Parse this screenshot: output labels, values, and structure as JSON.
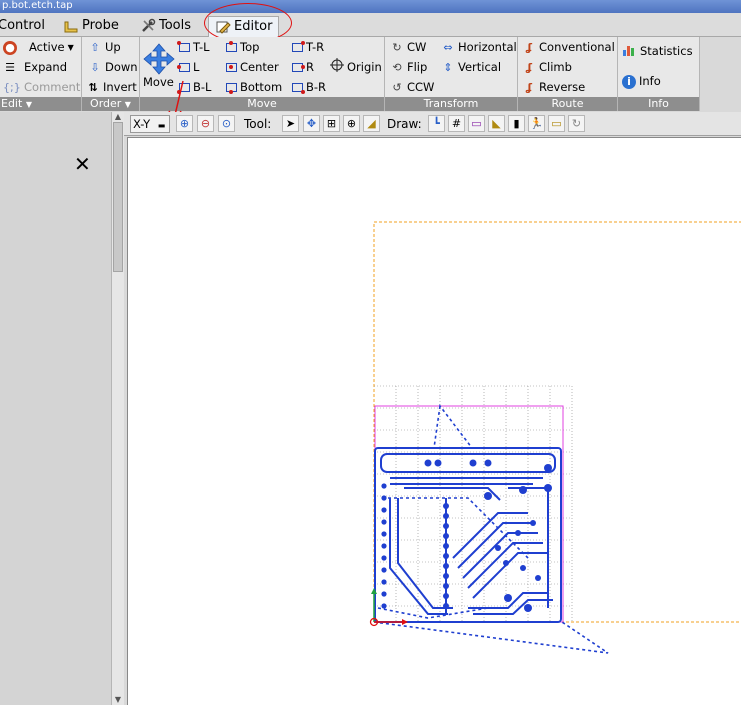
{
  "window": {
    "title": "p.bot.etch.tap"
  },
  "tabs": [
    {
      "label": "Control"
    },
    {
      "label": "Probe"
    },
    {
      "label": "Tools"
    },
    {
      "label": "Editor"
    }
  ],
  "ribbon": {
    "edit": {
      "label": "Edit",
      "active": "Active",
      "expand": "Expand",
      "comment": "Comment"
    },
    "order": {
      "label": "Order",
      "up": "Up",
      "down": "Down",
      "invert": "Invert"
    },
    "move": {
      "label": "Move",
      "move": "Move",
      "tl": "T-L",
      "top": "Top",
      "tr": "T-R",
      "l": "L",
      "center": "Center",
      "r": "R",
      "origin": "Origin",
      "bl": "B-L",
      "bottom": "Bottom",
      "br": "B-R"
    },
    "transform": {
      "label": "Transform",
      "cw": "CW",
      "horizontal": "Horizontal",
      "flip": "Flip",
      "vertical": "Vertical",
      "ccw": "CCW"
    },
    "route": {
      "label": "Route",
      "conventional": "Conventional",
      "climb": "Climb",
      "reverse": "Reverse"
    },
    "info": {
      "label": "Info",
      "statistics": "Statistics",
      "info": "Info"
    }
  },
  "canvas_toolbar": {
    "view": "X-Y",
    "tool_label": "Tool:",
    "draw_label": "Draw:"
  },
  "colors": {
    "accent_blue": "#1f3fd0",
    "annotation_red": "#e01010",
    "margin_orange": "#f0a020",
    "bbox_magenta": "#e040e0"
  }
}
